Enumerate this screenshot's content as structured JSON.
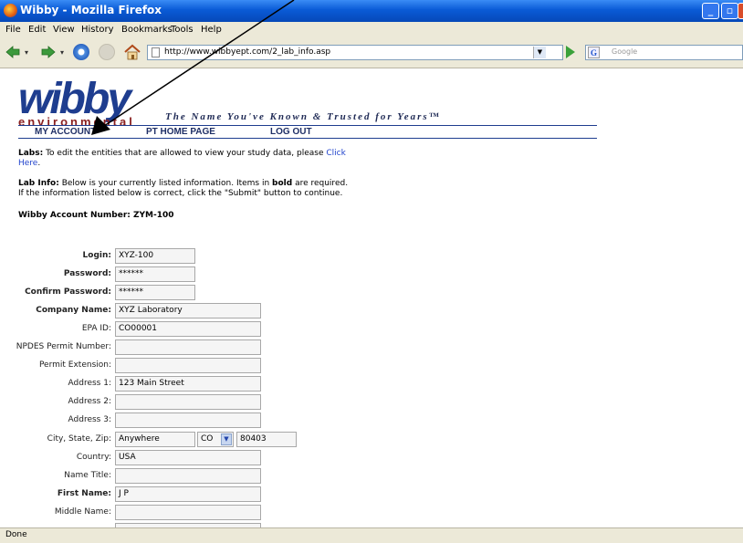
{
  "window": {
    "title": "Wibby - Mozilla Firefox"
  },
  "menu": [
    "File",
    "Edit",
    "View",
    "History",
    "Bookmarks",
    "Tools",
    "Help"
  ],
  "toolbar": {
    "url": "http://www.wibbyept.com/2_lab_info.asp",
    "search_placeholder": "Google"
  },
  "site": {
    "logo": "wibby",
    "logo_sub": "environmental",
    "tagline": "The Name You've Known & Trusted for Years™",
    "nav": [
      "MY ACCOUNT",
      "PT HOME PAGE",
      "LOG OUT"
    ]
  },
  "content": {
    "labs_label": "Labs:",
    "labs_text": " To edit the entities that are allowed to view your study data, please ",
    "labs_link": "Click Here",
    "labs_end": ".",
    "labinfo_label": "Lab Info:",
    "labinfo_text1": " Below is your currently listed information. Items in ",
    "labinfo_bold": "bold",
    "labinfo_text2": " are required.",
    "labinfo_line2": "If the information listed below is correct, click the \"Submit\" button to continue.",
    "account_number": "Wibby Account Number: ZYM-100"
  },
  "form": {
    "login": {
      "label": "Login:",
      "value": "XYZ-100"
    },
    "password": {
      "label": "Password:",
      "value": "******"
    },
    "confirm_password": {
      "label": "Confirm Password:",
      "value": "******"
    },
    "company_name": {
      "label": "Company Name:",
      "value": "XYZ Laboratory"
    },
    "epa_id": {
      "label": "EPA ID:",
      "value": "CO00001"
    },
    "npdes": {
      "label": "NPDES Permit Number:",
      "value": ""
    },
    "permit_ext": {
      "label": "Permit Extension:",
      "value": ""
    },
    "address1": {
      "label": "Address 1:",
      "value": "123 Main Street"
    },
    "address2": {
      "label": "Address 2:",
      "value": ""
    },
    "address3": {
      "label": "Address 3:",
      "value": ""
    },
    "city_state_zip": {
      "label": "City, State, Zip:",
      "city": "Anywhere",
      "state": "CO",
      "zip": "80403"
    },
    "country": {
      "label": "Country:",
      "value": "USA"
    },
    "name_title": {
      "label": "Name Title:",
      "value": ""
    },
    "first_name": {
      "label": "First Name:",
      "value": "J P"
    },
    "middle_name": {
      "label": "Middle Name:",
      "value": ""
    }
  },
  "status": "Done"
}
